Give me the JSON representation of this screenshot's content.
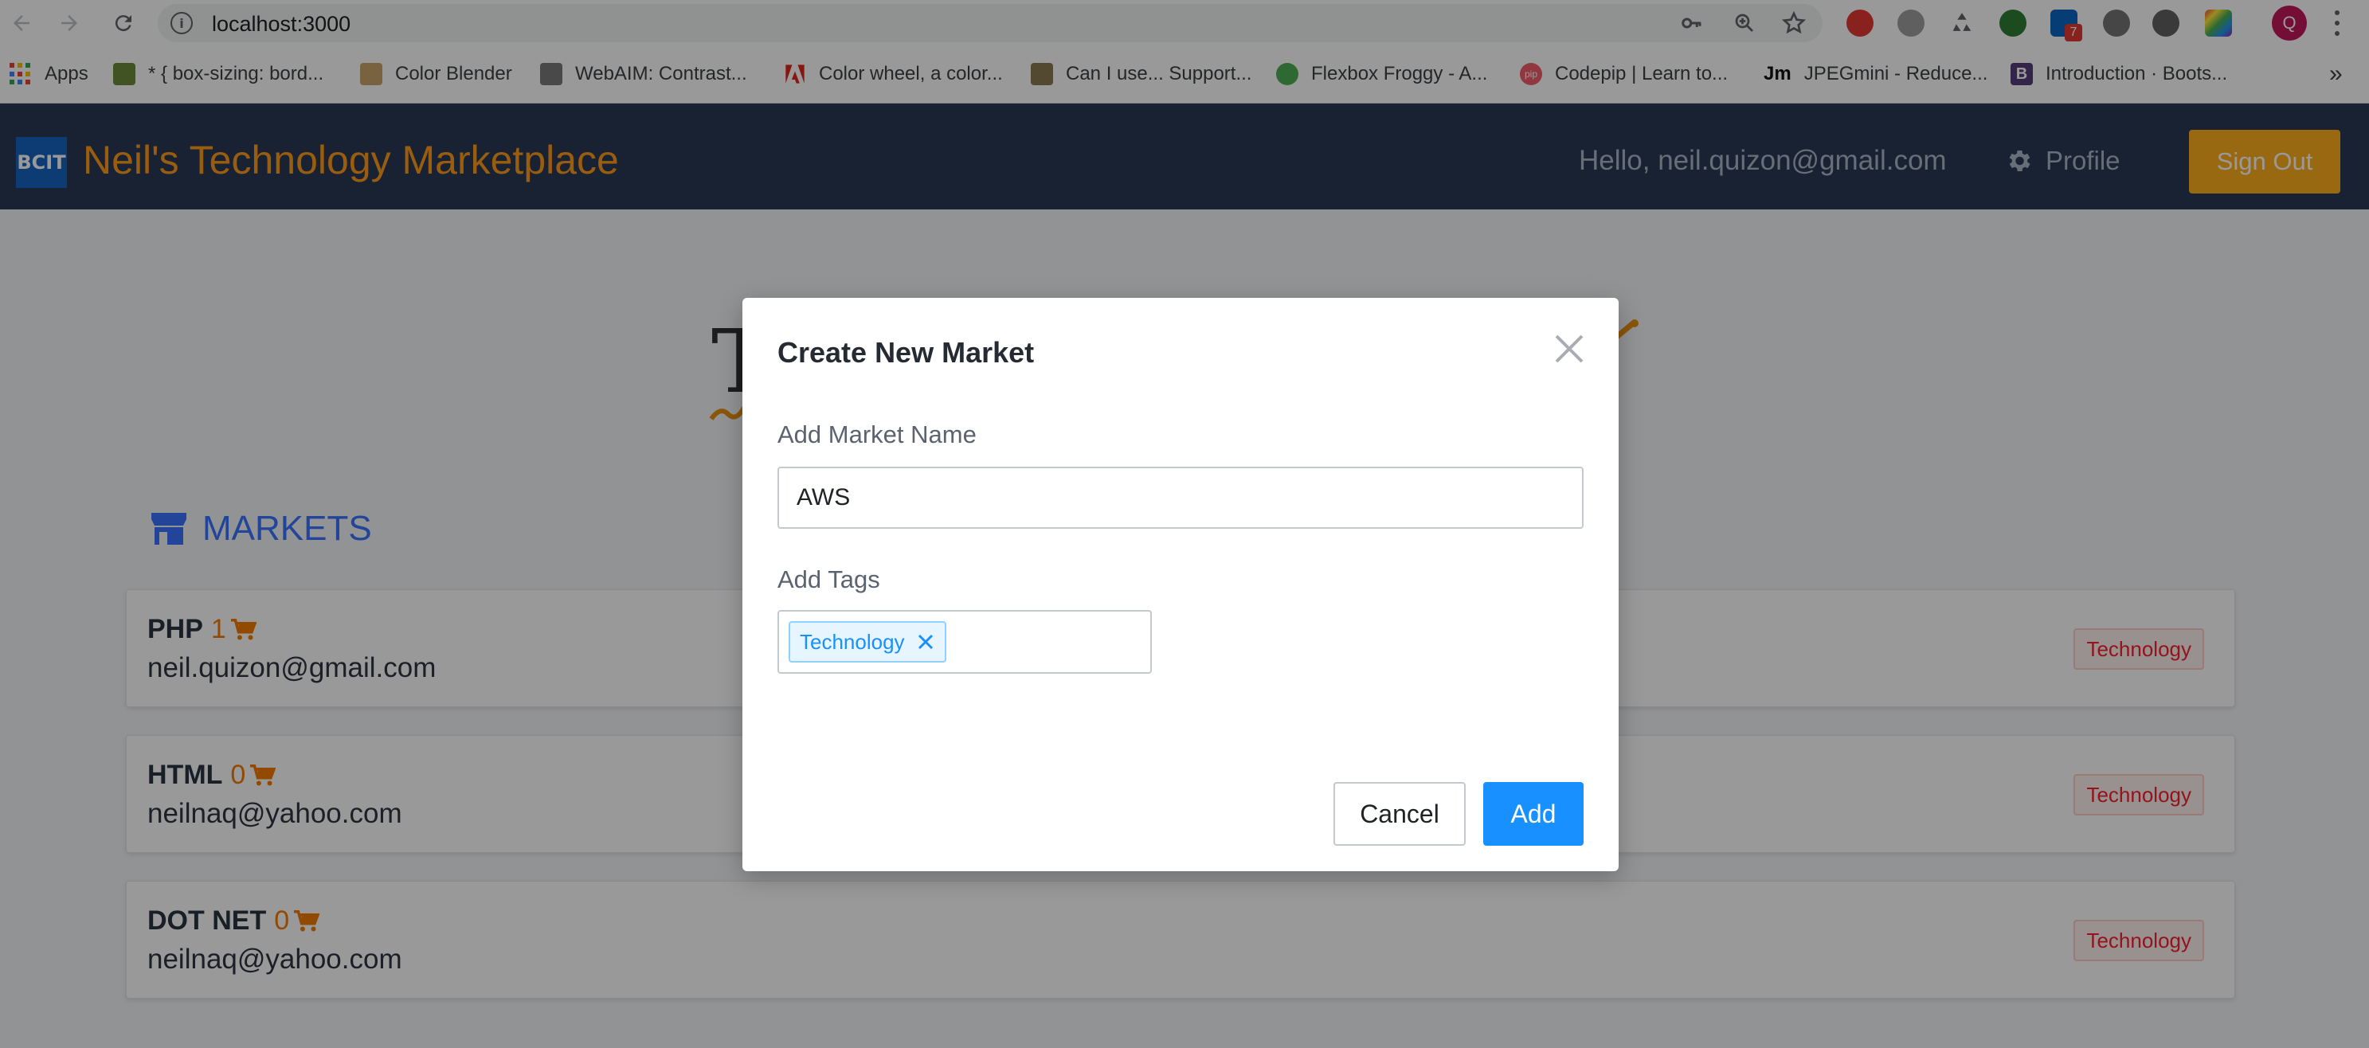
{
  "browser": {
    "url": "localhost:3000",
    "extension_badge": "7",
    "avatar_letter": "Q",
    "bookmarks": [
      {
        "label": "Apps",
        "icon": "apps-grid-icon"
      },
      {
        "label": "* { box-sizing: bord...",
        "icon": "favicon"
      },
      {
        "label": "Color Blender",
        "icon": "favicon"
      },
      {
        "label": "WebAIM: Contrast...",
        "icon": "favicon"
      },
      {
        "label": "Color wheel, a color...",
        "icon": "adobe-icon"
      },
      {
        "label": "Can I use... Support...",
        "icon": "favicon"
      },
      {
        "label": "Flexbox Froggy - A...",
        "icon": "frog-icon"
      },
      {
        "label": "Codepip | Learn to...",
        "icon": "favicon"
      },
      {
        "label": "JPEGmini - Reduce...",
        "icon": "favicon"
      },
      {
        "label": "Introduction · Boots...",
        "icon": "bootstrap-icon"
      }
    ],
    "jm_label": "Jm",
    "pip_label": "pip",
    "more_label": "»"
  },
  "app": {
    "logo_text": "BCIT",
    "title": "Neil's Technology Marketplace",
    "greeting": "Hello, neil.quizon@gmail.com",
    "profile_label": "Profile",
    "signout_label": "Sign Out",
    "hero_text": "T"
  },
  "markets": {
    "heading": "MARKETS",
    "items": [
      {
        "name": "PHP",
        "count": "1",
        "email": "neil.quizon@gmail.com",
        "tag": "Technology"
      },
      {
        "name": "HTML",
        "count": "0",
        "email": "neilnaq@yahoo.com",
        "tag": "Technology"
      },
      {
        "name": "DOT NET",
        "count": "0",
        "email": "neilnaq@yahoo.com",
        "tag": "Technology"
      }
    ]
  },
  "modal": {
    "title": "Create New Market",
    "name_label": "Add Market Name",
    "name_value": "AWS",
    "tags_label": "Add Tags",
    "tags": [
      "Technology"
    ],
    "cancel_label": "Cancel",
    "add_label": "Add"
  },
  "colors": {
    "nav_bg": "#2b3a54",
    "brand_orange": "#ff9b1a",
    "signout_bg": "#ffb01f",
    "markets_blue": "#3b73ff",
    "primary_blue": "#1890ff",
    "tag_red": "#f5222d"
  }
}
